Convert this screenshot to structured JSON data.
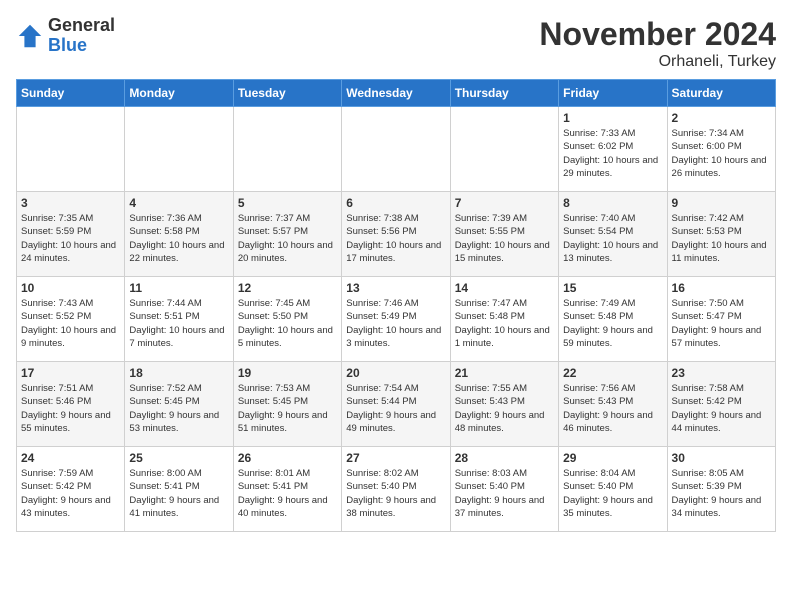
{
  "header": {
    "logo_general": "General",
    "logo_blue": "Blue",
    "month_title": "November 2024",
    "location": "Orhaneli, Turkey"
  },
  "days_of_week": [
    "Sunday",
    "Monday",
    "Tuesday",
    "Wednesday",
    "Thursday",
    "Friday",
    "Saturday"
  ],
  "weeks": [
    [
      {
        "day": "",
        "info": ""
      },
      {
        "day": "",
        "info": ""
      },
      {
        "day": "",
        "info": ""
      },
      {
        "day": "",
        "info": ""
      },
      {
        "day": "",
        "info": ""
      },
      {
        "day": "1",
        "info": "Sunrise: 7:33 AM\nSunset: 6:02 PM\nDaylight: 10 hours and 29 minutes."
      },
      {
        "day": "2",
        "info": "Sunrise: 7:34 AM\nSunset: 6:00 PM\nDaylight: 10 hours and 26 minutes."
      }
    ],
    [
      {
        "day": "3",
        "info": "Sunrise: 7:35 AM\nSunset: 5:59 PM\nDaylight: 10 hours and 24 minutes."
      },
      {
        "day": "4",
        "info": "Sunrise: 7:36 AM\nSunset: 5:58 PM\nDaylight: 10 hours and 22 minutes."
      },
      {
        "day": "5",
        "info": "Sunrise: 7:37 AM\nSunset: 5:57 PM\nDaylight: 10 hours and 20 minutes."
      },
      {
        "day": "6",
        "info": "Sunrise: 7:38 AM\nSunset: 5:56 PM\nDaylight: 10 hours and 17 minutes."
      },
      {
        "day": "7",
        "info": "Sunrise: 7:39 AM\nSunset: 5:55 PM\nDaylight: 10 hours and 15 minutes."
      },
      {
        "day": "8",
        "info": "Sunrise: 7:40 AM\nSunset: 5:54 PM\nDaylight: 10 hours and 13 minutes."
      },
      {
        "day": "9",
        "info": "Sunrise: 7:42 AM\nSunset: 5:53 PM\nDaylight: 10 hours and 11 minutes."
      }
    ],
    [
      {
        "day": "10",
        "info": "Sunrise: 7:43 AM\nSunset: 5:52 PM\nDaylight: 10 hours and 9 minutes."
      },
      {
        "day": "11",
        "info": "Sunrise: 7:44 AM\nSunset: 5:51 PM\nDaylight: 10 hours and 7 minutes."
      },
      {
        "day": "12",
        "info": "Sunrise: 7:45 AM\nSunset: 5:50 PM\nDaylight: 10 hours and 5 minutes."
      },
      {
        "day": "13",
        "info": "Sunrise: 7:46 AM\nSunset: 5:49 PM\nDaylight: 10 hours and 3 minutes."
      },
      {
        "day": "14",
        "info": "Sunrise: 7:47 AM\nSunset: 5:48 PM\nDaylight: 10 hours and 1 minute."
      },
      {
        "day": "15",
        "info": "Sunrise: 7:49 AM\nSunset: 5:48 PM\nDaylight: 9 hours and 59 minutes."
      },
      {
        "day": "16",
        "info": "Sunrise: 7:50 AM\nSunset: 5:47 PM\nDaylight: 9 hours and 57 minutes."
      }
    ],
    [
      {
        "day": "17",
        "info": "Sunrise: 7:51 AM\nSunset: 5:46 PM\nDaylight: 9 hours and 55 minutes."
      },
      {
        "day": "18",
        "info": "Sunrise: 7:52 AM\nSunset: 5:45 PM\nDaylight: 9 hours and 53 minutes."
      },
      {
        "day": "19",
        "info": "Sunrise: 7:53 AM\nSunset: 5:45 PM\nDaylight: 9 hours and 51 minutes."
      },
      {
        "day": "20",
        "info": "Sunrise: 7:54 AM\nSunset: 5:44 PM\nDaylight: 9 hours and 49 minutes."
      },
      {
        "day": "21",
        "info": "Sunrise: 7:55 AM\nSunset: 5:43 PM\nDaylight: 9 hours and 48 minutes."
      },
      {
        "day": "22",
        "info": "Sunrise: 7:56 AM\nSunset: 5:43 PM\nDaylight: 9 hours and 46 minutes."
      },
      {
        "day": "23",
        "info": "Sunrise: 7:58 AM\nSunset: 5:42 PM\nDaylight: 9 hours and 44 minutes."
      }
    ],
    [
      {
        "day": "24",
        "info": "Sunrise: 7:59 AM\nSunset: 5:42 PM\nDaylight: 9 hours and 43 minutes."
      },
      {
        "day": "25",
        "info": "Sunrise: 8:00 AM\nSunset: 5:41 PM\nDaylight: 9 hours and 41 minutes."
      },
      {
        "day": "26",
        "info": "Sunrise: 8:01 AM\nSunset: 5:41 PM\nDaylight: 9 hours and 40 minutes."
      },
      {
        "day": "27",
        "info": "Sunrise: 8:02 AM\nSunset: 5:40 PM\nDaylight: 9 hours and 38 minutes."
      },
      {
        "day": "28",
        "info": "Sunrise: 8:03 AM\nSunset: 5:40 PM\nDaylight: 9 hours and 37 minutes."
      },
      {
        "day": "29",
        "info": "Sunrise: 8:04 AM\nSunset: 5:40 PM\nDaylight: 9 hours and 35 minutes."
      },
      {
        "day": "30",
        "info": "Sunrise: 8:05 AM\nSunset: 5:39 PM\nDaylight: 9 hours and 34 minutes."
      }
    ]
  ]
}
